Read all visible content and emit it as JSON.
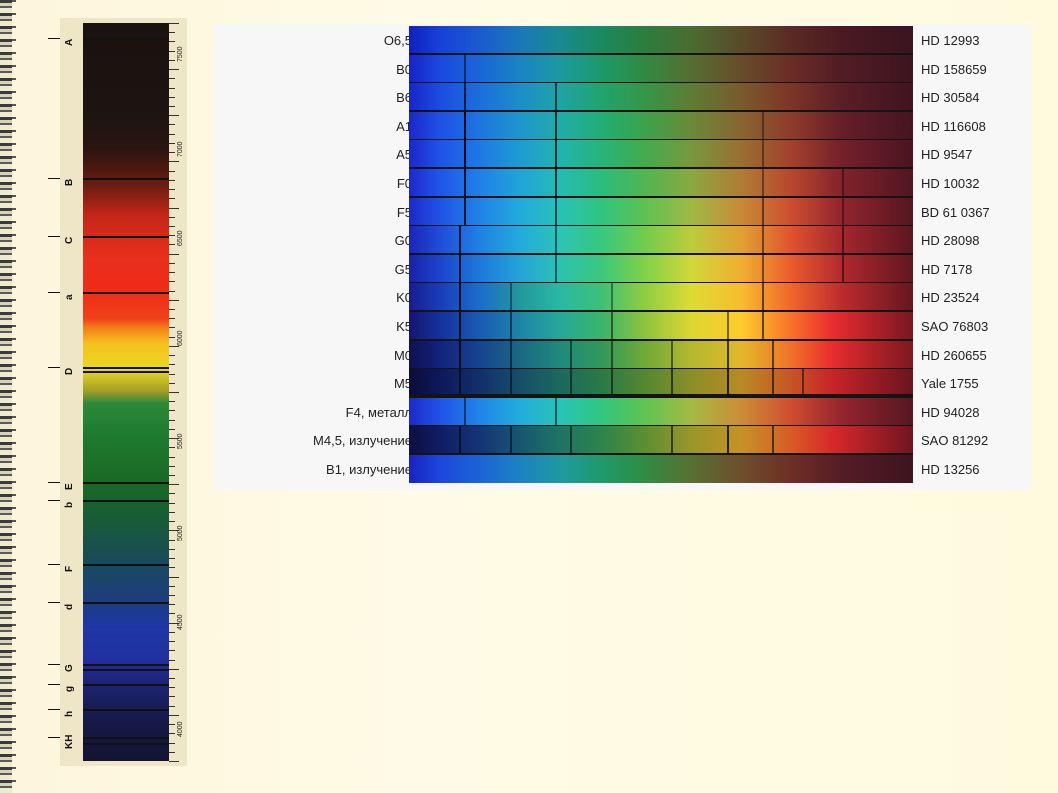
{
  "fraunhofer": {
    "lines": [
      {
        "label": "A",
        "pos": 0.02
      },
      {
        "label": "B",
        "pos": 0.21
      },
      {
        "label": "C",
        "pos": 0.288
      },
      {
        "label": "a",
        "pos": 0.365
      },
      {
        "label": "D",
        "pos": 0.466
      },
      {
        "label": "",
        "pos": 0.471
      },
      {
        "label": "E",
        "pos": 0.622
      },
      {
        "label": "b",
        "pos": 0.646
      },
      {
        "label": "F",
        "pos": 0.733
      },
      {
        "label": "d",
        "pos": 0.785
      },
      {
        "label": "G",
        "pos": 0.868
      },
      {
        "label": "",
        "pos": 0.876
      },
      {
        "label": "g",
        "pos": 0.895
      },
      {
        "label": "h",
        "pos": 0.93
      },
      {
        "label": "KH",
        "pos": 0.967
      },
      {
        "label": "",
        "pos": 0.976
      }
    ],
    "wavelengths": [
      {
        "label": "7500",
        "pos": 0.04
      },
      {
        "label": "7000",
        "pos": 0.17
      },
      {
        "label": "6500",
        "pos": 0.29
      },
      {
        "label": "6000",
        "pos": 0.425
      },
      {
        "label": "5500",
        "pos": 0.565
      },
      {
        "label": "5000",
        "pos": 0.69
      },
      {
        "label": "4500",
        "pos": 0.81
      },
      {
        "label": "4000",
        "pos": 0.955
      }
    ]
  },
  "spectra": [
    {
      "cls": "O6,5",
      "star": "HD 12993"
    },
    {
      "cls": "B0",
      "star": "HD 158659"
    },
    {
      "cls": "B6",
      "star": "HD 30584"
    },
    {
      "cls": "A1",
      "star": "HD 116608"
    },
    {
      "cls": "A5",
      "star": "HD 9547"
    },
    {
      "cls": "F0",
      "star": "HD 10032"
    },
    {
      "cls": "F5",
      "star": "BD 61 0367"
    },
    {
      "cls": "G0",
      "star": "HD 28098"
    },
    {
      "cls": "G5",
      "star": "HD 7178"
    },
    {
      "cls": "K0",
      "star": "HD 23524"
    },
    {
      "cls": "K5",
      "star": "SAO 76803"
    },
    {
      "cls": "M0",
      "star": "HD 260655"
    },
    {
      "cls": "M5",
      "star": "Yale 1755"
    },
    {
      "cls": "F4, металл",
      "star": "HD 94028"
    },
    {
      "cls": "M4,5, излучение",
      "star": "SAO 81292"
    },
    {
      "cls": "B1, излучение",
      "star": "HD 13256"
    }
  ]
}
